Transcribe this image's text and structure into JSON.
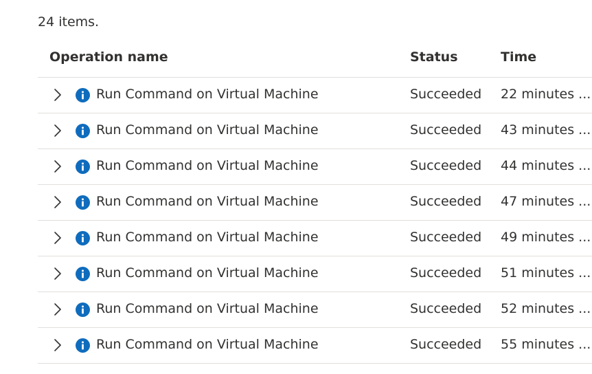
{
  "summary": {
    "count_text": "24 items."
  },
  "columns": {
    "name": "Operation name",
    "status": "Status",
    "time": "Time"
  },
  "colors": {
    "info_icon": "#0f6cbd",
    "divider": "#e1dfdd",
    "text": "#323130"
  },
  "rows": [
    {
      "icon": "info-icon",
      "name": "Run Command on Virtual Machine",
      "status": "Succeeded",
      "time": "22 minutes ..."
    },
    {
      "icon": "info-icon",
      "name": "Run Command on Virtual Machine",
      "status": "Succeeded",
      "time": "43 minutes ..."
    },
    {
      "icon": "info-icon",
      "name": "Run Command on Virtual Machine",
      "status": "Succeeded",
      "time": "44 minutes ..."
    },
    {
      "icon": "info-icon",
      "name": "Run Command on Virtual Machine",
      "status": "Succeeded",
      "time": "47 minutes ..."
    },
    {
      "icon": "info-icon",
      "name": "Run Command on Virtual Machine",
      "status": "Succeeded",
      "time": "49 minutes ..."
    },
    {
      "icon": "info-icon",
      "name": "Run Command on Virtual Machine",
      "status": "Succeeded",
      "time": "51 minutes ..."
    },
    {
      "icon": "info-icon",
      "name": "Run Command on Virtual Machine",
      "status": "Succeeded",
      "time": "52 minutes ..."
    },
    {
      "icon": "info-icon",
      "name": "Run Command on Virtual Machine",
      "status": "Succeeded",
      "time": "55 minutes ..."
    }
  ]
}
